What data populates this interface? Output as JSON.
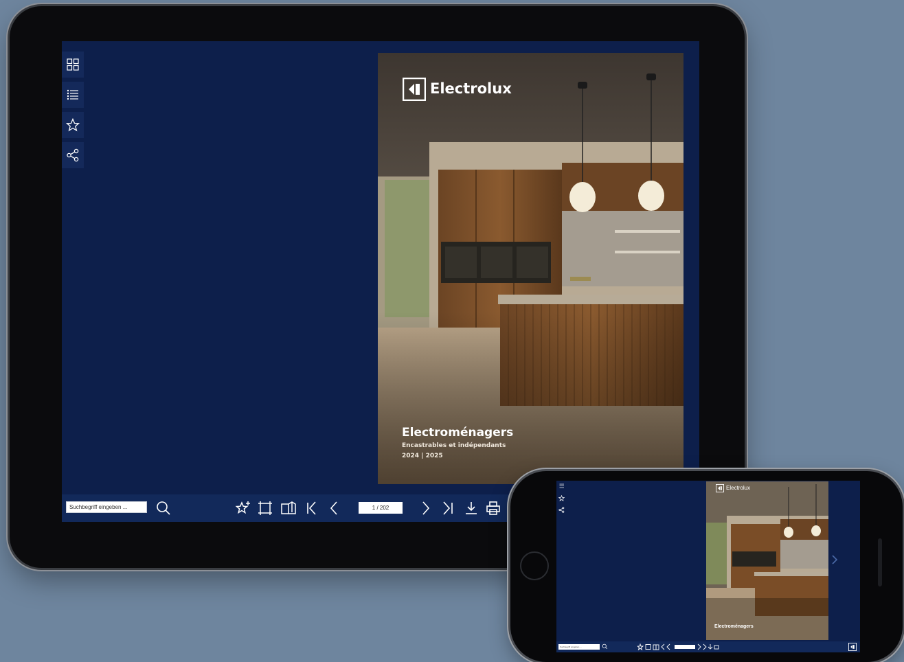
{
  "viewer": {
    "search_placeholder": "Suchbegriff eingeben ...",
    "page_indicator": "1 / 202",
    "sidebar": [
      {
        "icon": "grid-icon"
      },
      {
        "icon": "list-icon"
      },
      {
        "icon": "star-icon"
      },
      {
        "icon": "share-icon"
      }
    ],
    "toolbar_icons": [
      "search-icon",
      "add-bookmark-icon",
      "fullscreen-icon",
      "double-page-icon",
      "first-page-icon",
      "previous-page-icon",
      "next-page-icon",
      "last-page-icon",
      "download-icon",
      "print-icon"
    ]
  },
  "cover": {
    "brand": "Electrolux",
    "title": "Electroménagers",
    "subtitle": "Encastrables et indépendants",
    "year": "2024 | 2025"
  },
  "phone": {
    "brand": "Electrolux",
    "title": "Electroménagers"
  },
  "colors": {
    "background": "#6e859e",
    "viewer_bg": "#0d1f4b",
    "toolbar_bg": "#12295a"
  }
}
